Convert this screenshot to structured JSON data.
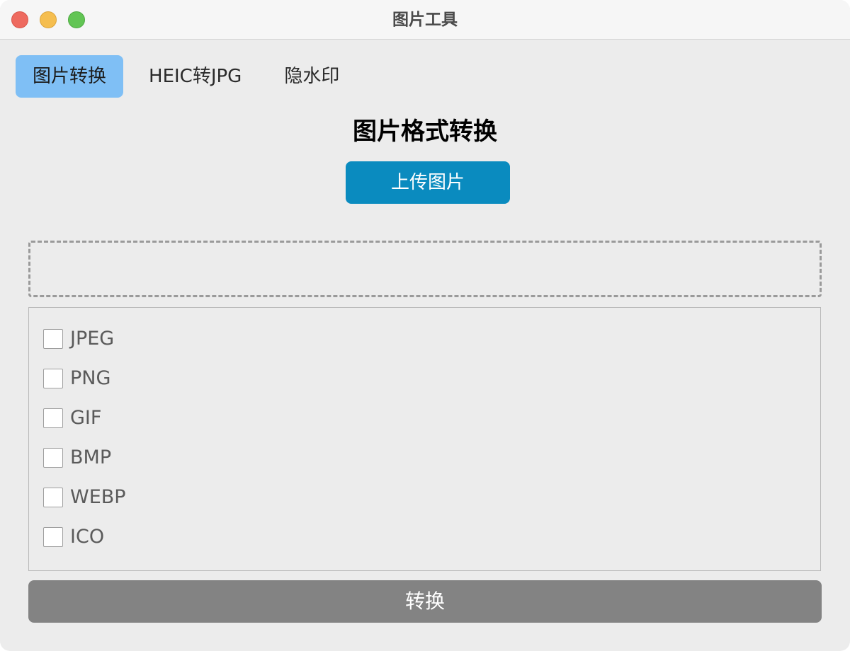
{
  "window": {
    "title": "图片工具"
  },
  "tabs": [
    {
      "label": "图片转换",
      "active": true
    },
    {
      "label": "HEIC转JPG",
      "active": false
    },
    {
      "label": "隐水印",
      "active": false
    }
  ],
  "main": {
    "heading": "图片格式转换",
    "upload_label": "上传图片",
    "dropzone_text": "",
    "formats": [
      {
        "label": "JPEG",
        "checked": false
      },
      {
        "label": "PNG",
        "checked": false
      },
      {
        "label": "GIF",
        "checked": false
      },
      {
        "label": "BMP",
        "checked": false
      },
      {
        "label": "WEBP",
        "checked": false
      },
      {
        "label": "ICO",
        "checked": false
      }
    ],
    "convert_label": "转换"
  },
  "colors": {
    "active_tab": "#7fbff5",
    "upload_button": "#0a8bbf",
    "convert_button": "#838383",
    "traffic_close": "#ee6a5f",
    "traffic_minimize": "#f5be4f",
    "traffic_zoom": "#62c554"
  }
}
